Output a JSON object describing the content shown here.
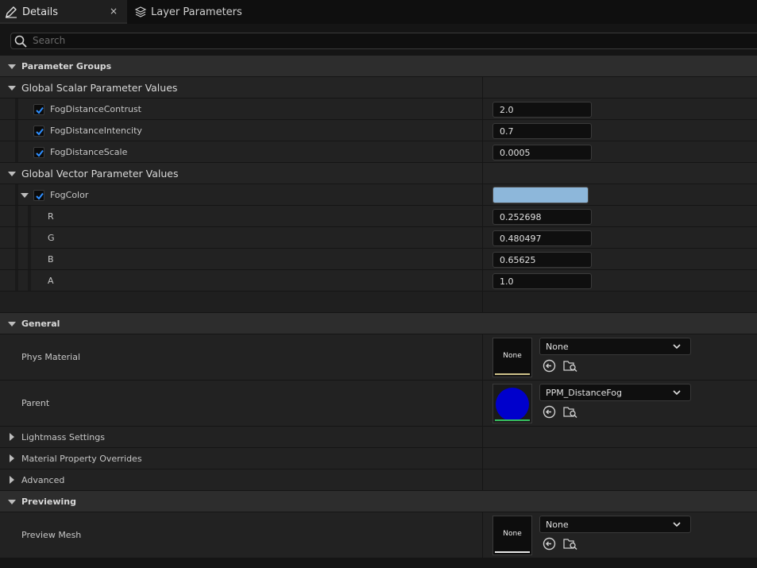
{
  "tabs": [
    {
      "label": "Details",
      "close": "×"
    },
    {
      "label": "Layer Parameters"
    }
  ],
  "search": {
    "placeholder": "Search"
  },
  "sections": {
    "parameter_groups": "Parameter Groups",
    "global_scalar": "Global Scalar Parameter Values",
    "global_vector": "Global Vector Parameter Values",
    "general": "General",
    "lightmass": "Lightmass Settings",
    "material_overrides": "Material Property Overrides",
    "advanced": "Advanced",
    "previewing": "Previewing"
  },
  "scalar_params": [
    {
      "name": "FogDistanceContrust",
      "value": "2.0",
      "checked": true
    },
    {
      "name": "FogDistanceIntencity",
      "value": "0.7",
      "checked": true
    },
    {
      "name": "FogDistanceScale",
      "value": "0.0005",
      "checked": true
    }
  ],
  "vector_param": {
    "name": "FogColor",
    "checked": true,
    "swatch": "#8db7da",
    "channels": [
      {
        "label": "R",
        "value": "0.252698"
      },
      {
        "label": "G",
        "value": "0.480497"
      },
      {
        "label": "B",
        "value": "0.65625"
      },
      {
        "label": "A",
        "value": "1.0"
      }
    ]
  },
  "general": {
    "phys_material": {
      "label": "Phys Material",
      "thumb": "None",
      "value": "None",
      "underline": "#cfc28a"
    },
    "parent": {
      "label": "Parent",
      "value": "PPM_DistanceFog",
      "underline": "#36c060",
      "sphere": "#0000cc"
    }
  },
  "previewing": {
    "preview_mesh": {
      "label": "Preview Mesh",
      "thumb": "None",
      "value": "None",
      "underline": "#e8e8e8"
    }
  },
  "icons": [
    "pencil-icon",
    "close-icon",
    "layers-icon",
    "search-icon",
    "checkbox-checked-icon",
    "collapse-arrow-icon",
    "expand-arrow-icon",
    "chevron-down-icon",
    "use-selected-icon",
    "browse-icon"
  ],
  "colors": {
    "checkbox_accent": "#2f8fff",
    "panel": "#222222",
    "header": "#2d2d2d"
  }
}
